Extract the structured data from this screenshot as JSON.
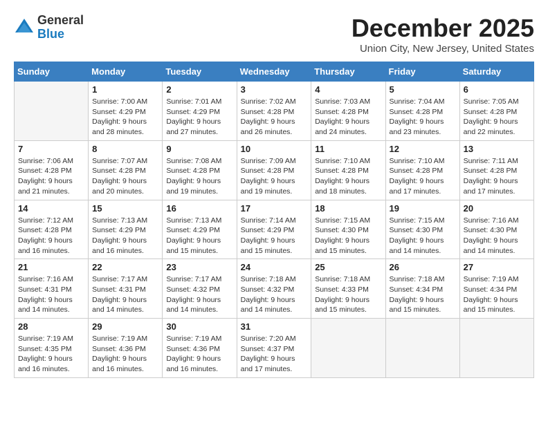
{
  "header": {
    "logo": {
      "general": "General",
      "blue": "Blue"
    },
    "title": "December 2025",
    "location": "Union City, New Jersey, United States"
  },
  "days_header": [
    "Sunday",
    "Monday",
    "Tuesday",
    "Wednesday",
    "Thursday",
    "Friday",
    "Saturday"
  ],
  "weeks": [
    [
      {
        "day": "",
        "info": ""
      },
      {
        "day": "1",
        "info": "Sunrise: 7:00 AM\nSunset: 4:29 PM\nDaylight: 9 hours\nand 28 minutes."
      },
      {
        "day": "2",
        "info": "Sunrise: 7:01 AM\nSunset: 4:29 PM\nDaylight: 9 hours\nand 27 minutes."
      },
      {
        "day": "3",
        "info": "Sunrise: 7:02 AM\nSunset: 4:28 PM\nDaylight: 9 hours\nand 26 minutes."
      },
      {
        "day": "4",
        "info": "Sunrise: 7:03 AM\nSunset: 4:28 PM\nDaylight: 9 hours\nand 24 minutes."
      },
      {
        "day": "5",
        "info": "Sunrise: 7:04 AM\nSunset: 4:28 PM\nDaylight: 9 hours\nand 23 minutes."
      },
      {
        "day": "6",
        "info": "Sunrise: 7:05 AM\nSunset: 4:28 PM\nDaylight: 9 hours\nand 22 minutes."
      }
    ],
    [
      {
        "day": "7",
        "info": "Sunrise: 7:06 AM\nSunset: 4:28 PM\nDaylight: 9 hours\nand 21 minutes."
      },
      {
        "day": "8",
        "info": "Sunrise: 7:07 AM\nSunset: 4:28 PM\nDaylight: 9 hours\nand 20 minutes."
      },
      {
        "day": "9",
        "info": "Sunrise: 7:08 AM\nSunset: 4:28 PM\nDaylight: 9 hours\nand 19 minutes."
      },
      {
        "day": "10",
        "info": "Sunrise: 7:09 AM\nSunset: 4:28 PM\nDaylight: 9 hours\nand 19 minutes."
      },
      {
        "day": "11",
        "info": "Sunrise: 7:10 AM\nSunset: 4:28 PM\nDaylight: 9 hours\nand 18 minutes."
      },
      {
        "day": "12",
        "info": "Sunrise: 7:10 AM\nSunset: 4:28 PM\nDaylight: 9 hours\nand 17 minutes."
      },
      {
        "day": "13",
        "info": "Sunrise: 7:11 AM\nSunset: 4:28 PM\nDaylight: 9 hours\nand 17 minutes."
      }
    ],
    [
      {
        "day": "14",
        "info": "Sunrise: 7:12 AM\nSunset: 4:28 PM\nDaylight: 9 hours\nand 16 minutes."
      },
      {
        "day": "15",
        "info": "Sunrise: 7:13 AM\nSunset: 4:29 PM\nDaylight: 9 hours\nand 16 minutes."
      },
      {
        "day": "16",
        "info": "Sunrise: 7:13 AM\nSunset: 4:29 PM\nDaylight: 9 hours\nand 15 minutes."
      },
      {
        "day": "17",
        "info": "Sunrise: 7:14 AM\nSunset: 4:29 PM\nDaylight: 9 hours\nand 15 minutes."
      },
      {
        "day": "18",
        "info": "Sunrise: 7:15 AM\nSunset: 4:30 PM\nDaylight: 9 hours\nand 15 minutes."
      },
      {
        "day": "19",
        "info": "Sunrise: 7:15 AM\nSunset: 4:30 PM\nDaylight: 9 hours\nand 14 minutes."
      },
      {
        "day": "20",
        "info": "Sunrise: 7:16 AM\nSunset: 4:30 PM\nDaylight: 9 hours\nand 14 minutes."
      }
    ],
    [
      {
        "day": "21",
        "info": "Sunrise: 7:16 AM\nSunset: 4:31 PM\nDaylight: 9 hours\nand 14 minutes."
      },
      {
        "day": "22",
        "info": "Sunrise: 7:17 AM\nSunset: 4:31 PM\nDaylight: 9 hours\nand 14 minutes."
      },
      {
        "day": "23",
        "info": "Sunrise: 7:17 AM\nSunset: 4:32 PM\nDaylight: 9 hours\nand 14 minutes."
      },
      {
        "day": "24",
        "info": "Sunrise: 7:18 AM\nSunset: 4:32 PM\nDaylight: 9 hours\nand 14 minutes."
      },
      {
        "day": "25",
        "info": "Sunrise: 7:18 AM\nSunset: 4:33 PM\nDaylight: 9 hours\nand 15 minutes."
      },
      {
        "day": "26",
        "info": "Sunrise: 7:18 AM\nSunset: 4:34 PM\nDaylight: 9 hours\nand 15 minutes."
      },
      {
        "day": "27",
        "info": "Sunrise: 7:19 AM\nSunset: 4:34 PM\nDaylight: 9 hours\nand 15 minutes."
      }
    ],
    [
      {
        "day": "28",
        "info": "Sunrise: 7:19 AM\nSunset: 4:35 PM\nDaylight: 9 hours\nand 16 minutes."
      },
      {
        "day": "29",
        "info": "Sunrise: 7:19 AM\nSunset: 4:36 PM\nDaylight: 9 hours\nand 16 minutes."
      },
      {
        "day": "30",
        "info": "Sunrise: 7:19 AM\nSunset: 4:36 PM\nDaylight: 9 hours\nand 16 minutes."
      },
      {
        "day": "31",
        "info": "Sunrise: 7:20 AM\nSunset: 4:37 PM\nDaylight: 9 hours\nand 17 minutes."
      },
      {
        "day": "",
        "info": ""
      },
      {
        "day": "",
        "info": ""
      },
      {
        "day": "",
        "info": ""
      }
    ]
  ]
}
